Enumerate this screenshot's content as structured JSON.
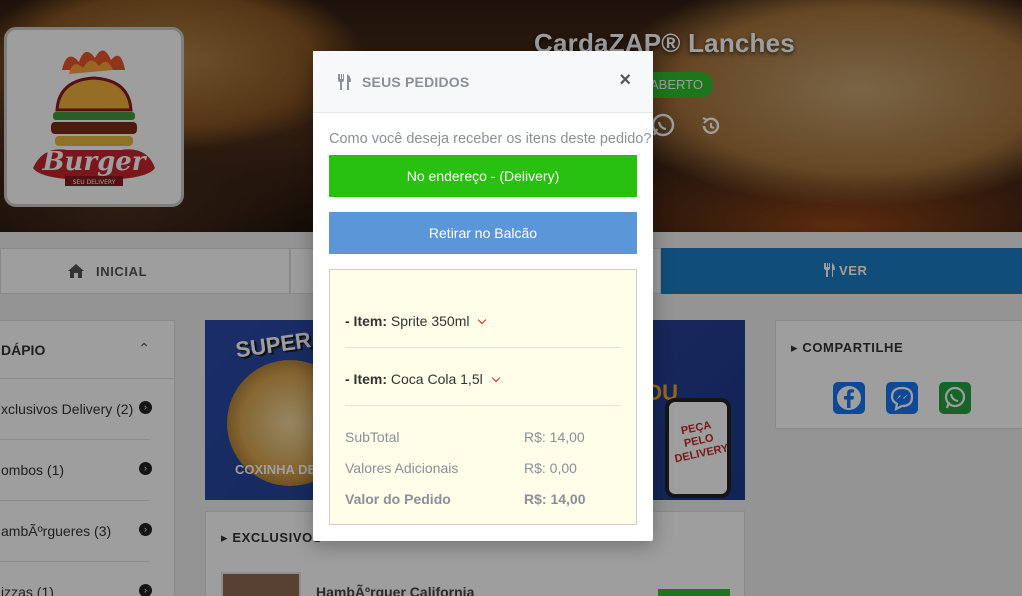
{
  "restaurant": {
    "name": "CardaZAP® Lanches",
    "status": "ABERTO",
    "logo_text": "Burger",
    "logo_subtext": "SEU DELIVERY"
  },
  "nav": {
    "home_label": "INICIAL",
    "ver_label": "VER"
  },
  "sidebar": {
    "title": "DÁPIO",
    "categories": [
      {
        "label": "xclusivos Delivery (2)"
      },
      {
        "label": "ombos (1)"
      },
      {
        "label": "ambÃºrgueres (3)"
      },
      {
        "label": "izzas (1)"
      }
    ]
  },
  "banner": {
    "super_text": "SUPER COMBO",
    "coxinha_text": "COXINHA DE FRA",
    "ou_text": "OU",
    "phone_text": "PEÇA PELO DELIVERY"
  },
  "products": {
    "section_title": "EXCLUSIVOS",
    "first_product": "HambÃºrguer California"
  },
  "share": {
    "title": "COMPARTILHE"
  },
  "modal": {
    "title": "SEUS PEDIDOS",
    "close": "×",
    "question": "Como você deseja receber os itens deste pedido?",
    "delivery_button": "No endereço - (Delivery)",
    "pickup_button": "Retirar no Balcão",
    "items": [
      {
        "prefix": "- Item:",
        "name": "Sprite 350ml"
      },
      {
        "prefix": "- Item:",
        "name": "Coca Cola 1,5l"
      }
    ],
    "summary": {
      "subtotal_label": "SubTotal",
      "subtotal_value": "R$: 14,00",
      "additional_label": "Valores Adicionais",
      "additional_value": "R$: 0,00",
      "total_label": "Valor do Pedido",
      "total_value": "R$: 14,00"
    }
  },
  "colors": {
    "delivery_green": "#29c10f",
    "pickup_blue": "#5b96d8",
    "order_box_bg": "#fefee9",
    "nav_blue": "#1a7dc4",
    "status_green": "#2ec02e"
  }
}
